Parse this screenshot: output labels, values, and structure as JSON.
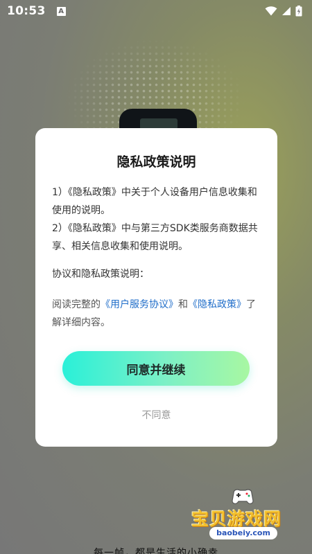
{
  "status_bar": {
    "time": "10:53",
    "notification_icon_letter": "A",
    "icons": [
      "wifi-icon",
      "signal-icon",
      "battery-charging-icon"
    ]
  },
  "background": {
    "tagline": "每一帧，都是生活的小确幸"
  },
  "dialog": {
    "title": "隐私政策说明",
    "items": [
      "1）《隐私政策》中关于个人设备用户信息收集和使用的说明。",
      "2）《隐私政策》中与第三方SDK类服务商数据共享、相关信息收集和使用说明。"
    ],
    "section_title": "协议和隐私政策说明：",
    "read_prefix": "阅读完整的",
    "user_agreement_link": "《用户服务协议》",
    "read_and": "和",
    "privacy_policy_link": "《隐私政策》",
    "read_suffix": "了解详细内容。",
    "agree_button": "同意并继续",
    "disagree_button": "不同意"
  },
  "watermark": {
    "name": "宝贝游戏网",
    "domain": "baobeiy.com"
  },
  "colors": {
    "link": "#1f6dc9",
    "button_gradient_start": "#2af0d8",
    "button_gradient_end": "#a8f7a2",
    "disagree_text": "#9a9a9a"
  }
}
